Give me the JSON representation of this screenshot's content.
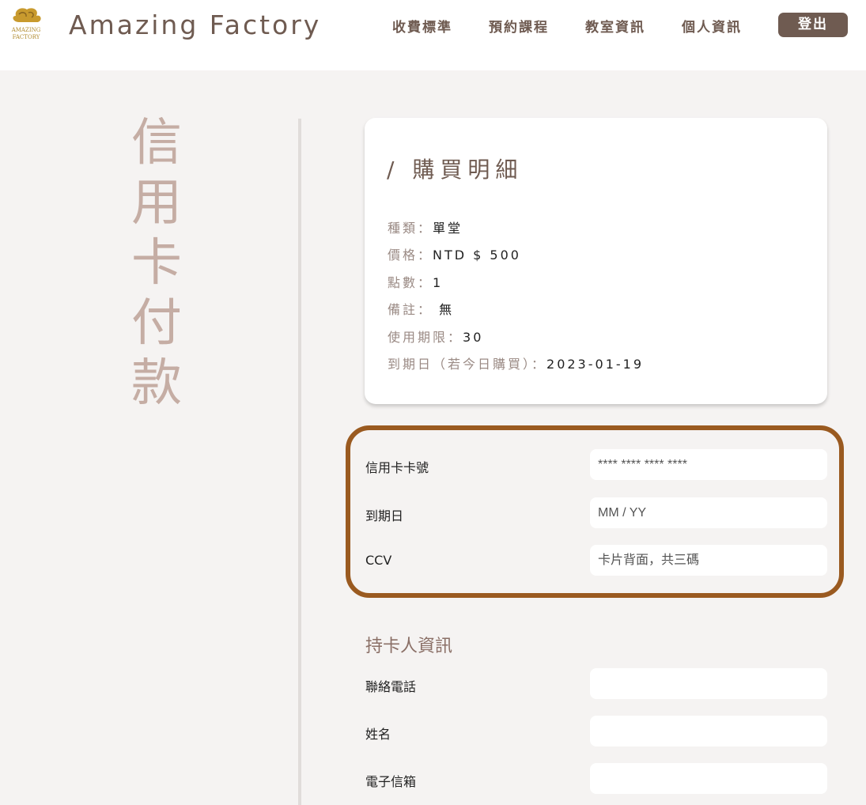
{
  "header": {
    "brand": "Amazing Factory",
    "logo_text_top": "AMAZING",
    "logo_text_bottom": "FACTORY",
    "nav": [
      "收費標準",
      "預約課程",
      "教室資訊",
      "個人資訊"
    ],
    "logout": "登出"
  },
  "page_title": [
    "信",
    "用",
    "卡",
    "付",
    "款"
  ],
  "purchase": {
    "title": "/  購買明細",
    "rows": [
      {
        "label": "種類：",
        "value": "單堂"
      },
      {
        "label": "價格：",
        "value": "NTD $ 500"
      },
      {
        "label": "點數：",
        "value": "1"
      },
      {
        "label": "備註：",
        "value": " 無"
      },
      {
        "label": "使用期限：",
        "value": "30"
      },
      {
        "label": "到期日（若今日購買）：",
        "value": "2023-01-19"
      }
    ]
  },
  "credit_card": {
    "number_label": "信用卡卡號",
    "number_placeholder": "**** **** **** ****",
    "expiry_label": "到期日",
    "expiry_placeholder": "MM / YY",
    "ccv_label": "CCV",
    "ccv_placeholder": "卡片背面，共三碼"
  },
  "holder": {
    "title": "持卡人資訊",
    "phone_label": "聯絡電話",
    "name_label": "姓名",
    "email_label": "電子信箱"
  },
  "colors": {
    "brand": "#6f5b51",
    "title_accent": "#c5ada4",
    "highlight_border": "#9a5a20",
    "page_bg": "#f5f3f2"
  }
}
